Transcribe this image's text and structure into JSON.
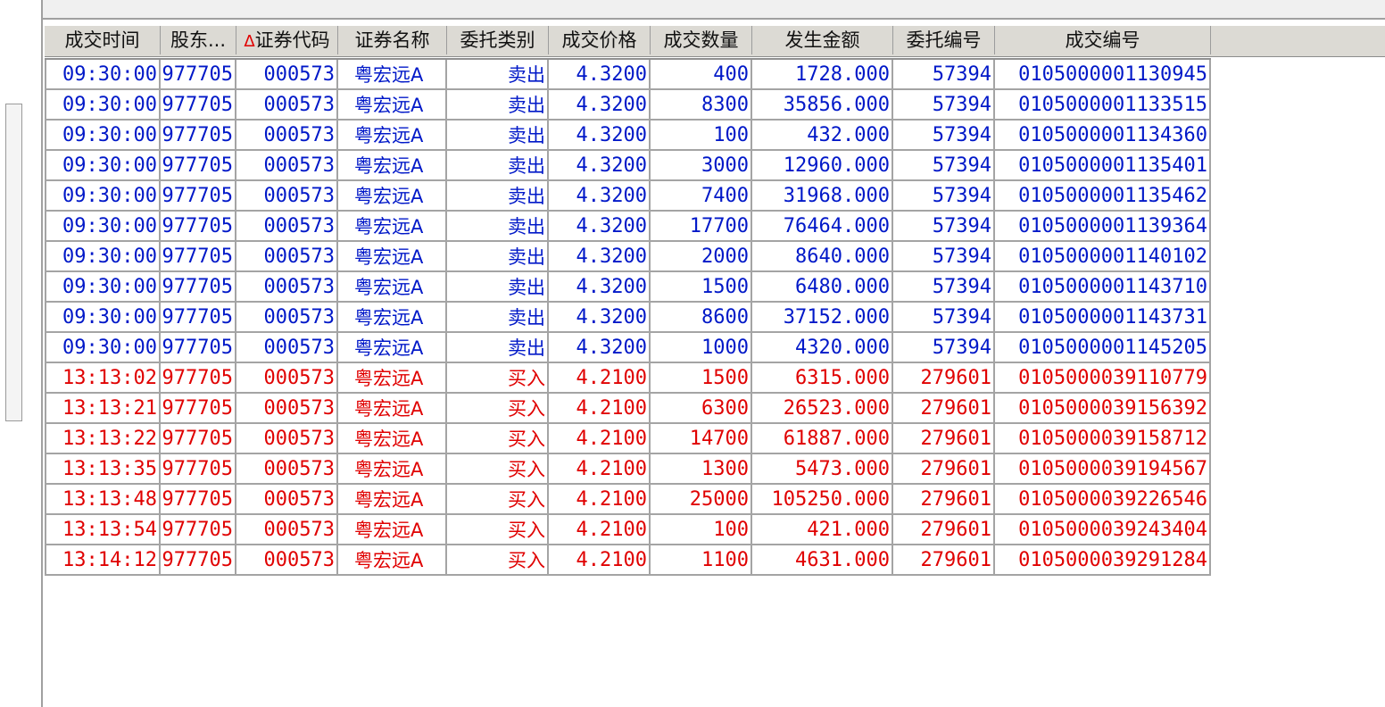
{
  "colors": {
    "sell": "#0018c8",
    "buy": "#e00000",
    "sort_indicator": "#e00000"
  },
  "header": {
    "columns": [
      "成交时间",
      "股东...",
      "证券代码",
      "证券名称",
      "委托类别",
      "成交价格",
      "成交数量",
      "发生金额",
      "委托编号",
      "成交编号"
    ],
    "sort_indicator": "Δ"
  },
  "rows": [
    {
      "side": "sell",
      "time": "09:30:00",
      "account": "977705",
      "code": "000573",
      "name": "粤宏远A",
      "type": "卖出",
      "price": "4.3200",
      "qty": "400",
      "amount": "1728.000",
      "order_no": "57394",
      "deal_no": "0105000001130945"
    },
    {
      "side": "sell",
      "time": "09:30:00",
      "account": "977705",
      "code": "000573",
      "name": "粤宏远A",
      "type": "卖出",
      "price": "4.3200",
      "qty": "8300",
      "amount": "35856.000",
      "order_no": "57394",
      "deal_no": "0105000001133515"
    },
    {
      "side": "sell",
      "time": "09:30:00",
      "account": "977705",
      "code": "000573",
      "name": "粤宏远A",
      "type": "卖出",
      "price": "4.3200",
      "qty": "100",
      "amount": "432.000",
      "order_no": "57394",
      "deal_no": "0105000001134360"
    },
    {
      "side": "sell",
      "time": "09:30:00",
      "account": "977705",
      "code": "000573",
      "name": "粤宏远A",
      "type": "卖出",
      "price": "4.3200",
      "qty": "3000",
      "amount": "12960.000",
      "order_no": "57394",
      "deal_no": "0105000001135401"
    },
    {
      "side": "sell",
      "time": "09:30:00",
      "account": "977705",
      "code": "000573",
      "name": "粤宏远A",
      "type": "卖出",
      "price": "4.3200",
      "qty": "7400",
      "amount": "31968.000",
      "order_no": "57394",
      "deal_no": "0105000001135462"
    },
    {
      "side": "sell",
      "time": "09:30:00",
      "account": "977705",
      "code": "000573",
      "name": "粤宏远A",
      "type": "卖出",
      "price": "4.3200",
      "qty": "17700",
      "amount": "76464.000",
      "order_no": "57394",
      "deal_no": "0105000001139364"
    },
    {
      "side": "sell",
      "time": "09:30:00",
      "account": "977705",
      "code": "000573",
      "name": "粤宏远A",
      "type": "卖出",
      "price": "4.3200",
      "qty": "2000",
      "amount": "8640.000",
      "order_no": "57394",
      "deal_no": "0105000001140102"
    },
    {
      "side": "sell",
      "time": "09:30:00",
      "account": "977705",
      "code": "000573",
      "name": "粤宏远A",
      "type": "卖出",
      "price": "4.3200",
      "qty": "1500",
      "amount": "6480.000",
      "order_no": "57394",
      "deal_no": "0105000001143710"
    },
    {
      "side": "sell",
      "time": "09:30:00",
      "account": "977705",
      "code": "000573",
      "name": "粤宏远A",
      "type": "卖出",
      "price": "4.3200",
      "qty": "8600",
      "amount": "37152.000",
      "order_no": "57394",
      "deal_no": "0105000001143731"
    },
    {
      "side": "sell",
      "time": "09:30:00",
      "account": "977705",
      "code": "000573",
      "name": "粤宏远A",
      "type": "卖出",
      "price": "4.3200",
      "qty": "1000",
      "amount": "4320.000",
      "order_no": "57394",
      "deal_no": "0105000001145205"
    },
    {
      "side": "buy",
      "time": "13:13:02",
      "account": "977705",
      "code": "000573",
      "name": "粤宏远A",
      "type": "买入",
      "price": "4.2100",
      "qty": "1500",
      "amount": "6315.000",
      "order_no": "279601",
      "deal_no": "0105000039110779"
    },
    {
      "side": "buy",
      "time": "13:13:21",
      "account": "977705",
      "code": "000573",
      "name": "粤宏远A",
      "type": "买入",
      "price": "4.2100",
      "qty": "6300",
      "amount": "26523.000",
      "order_no": "279601",
      "deal_no": "0105000039156392"
    },
    {
      "side": "buy",
      "time": "13:13:22",
      "account": "977705",
      "code": "000573",
      "name": "粤宏远A",
      "type": "买入",
      "price": "4.2100",
      "qty": "14700",
      "amount": "61887.000",
      "order_no": "279601",
      "deal_no": "0105000039158712"
    },
    {
      "side": "buy",
      "time": "13:13:35",
      "account": "977705",
      "code": "000573",
      "name": "粤宏远A",
      "type": "买入",
      "price": "4.2100",
      "qty": "1300",
      "amount": "5473.000",
      "order_no": "279601",
      "deal_no": "0105000039194567"
    },
    {
      "side": "buy",
      "time": "13:13:48",
      "account": "977705",
      "code": "000573",
      "name": "粤宏远A",
      "type": "买入",
      "price": "4.2100",
      "qty": "25000",
      "amount": "105250.000",
      "order_no": "279601",
      "deal_no": "0105000039226546"
    },
    {
      "side": "buy",
      "time": "13:13:54",
      "account": "977705",
      "code": "000573",
      "name": "粤宏远A",
      "type": "买入",
      "price": "4.2100",
      "qty": "100",
      "amount": "421.000",
      "order_no": "279601",
      "deal_no": "0105000039243404"
    },
    {
      "side": "buy",
      "time": "13:14:12",
      "account": "977705",
      "code": "000573",
      "name": "粤宏远A",
      "type": "买入",
      "price": "4.2100",
      "qty": "1100",
      "amount": "4631.000",
      "order_no": "279601",
      "deal_no": "0105000039291284"
    }
  ]
}
